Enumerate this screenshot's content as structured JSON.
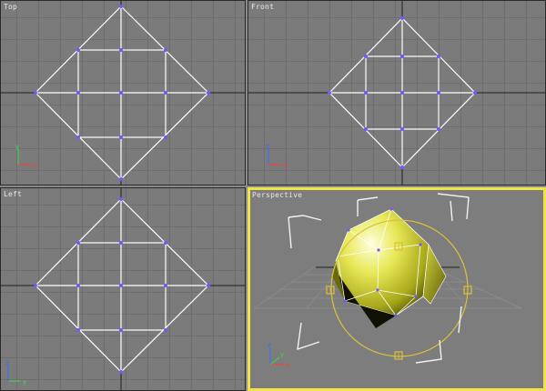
{
  "viewports": {
    "top": {
      "label": "Top"
    },
    "front": {
      "label": "Front"
    },
    "left": {
      "label": "Left"
    },
    "perspective": {
      "label": "Perspective",
      "active": true
    }
  },
  "colors": {
    "viewport_bg": "#7b7b7b",
    "grid_line": "#6e6e6e",
    "wire": "#ffffff",
    "vertex": "#6a5cff",
    "active_border": "#f2e34a",
    "gizmo": "#d8c23a",
    "axis_x": "#ff3b3b",
    "axis_y": "#38d84a",
    "axis_z": "#3a6bff"
  },
  "icons": {
    "axis": "axis-tripod-icon",
    "gizmo": "rotate-gizmo-icon"
  }
}
